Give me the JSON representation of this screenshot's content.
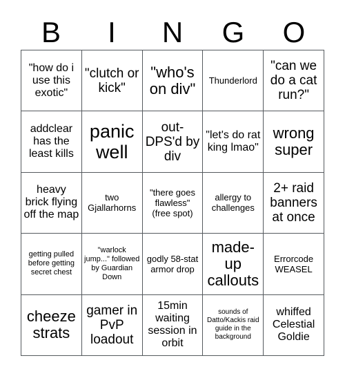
{
  "card": {
    "title": "BINGO",
    "colors": {
      "background": "#ffffff",
      "border": "#555a5e",
      "text": "#000000"
    },
    "header": {
      "letters": [
        {
          "label": "B"
        },
        {
          "label": "I"
        },
        {
          "label": "N"
        },
        {
          "label": "G"
        },
        {
          "label": "O"
        }
      ]
    },
    "grid": {
      "rows": 5,
      "columns": 5,
      "cells": [
        {
          "text": "\"how do i use this exotic\"",
          "size": "md",
          "marked": false
        },
        {
          "text": "\"clutch or kick\"",
          "size": "lg",
          "marked": false
        },
        {
          "text": "\"who's on div\"",
          "size": "xl",
          "marked": false
        },
        {
          "text": "Thunderlord",
          "size": "sm",
          "marked": false
        },
        {
          "text": "\"can we do a cat run?\"",
          "size": "lg",
          "marked": false
        },
        {
          "text": "addclear has the least kills",
          "size": "md",
          "marked": false
        },
        {
          "text": "panic well",
          "size": "xxl",
          "marked": false
        },
        {
          "text": "out-DPS'd by div",
          "size": "lg",
          "marked": false
        },
        {
          "text": "\"let's do rat king lmao\"",
          "size": "md",
          "marked": false
        },
        {
          "text": "wrong super",
          "size": "xl",
          "marked": false
        },
        {
          "text": "heavy brick flying off the map",
          "size": "md",
          "marked": false
        },
        {
          "text": "two Gjallarhorns",
          "size": "sm",
          "marked": false
        },
        {
          "text": "\"there goes flawless\" (free spot)",
          "size": "sm",
          "marked": false
        },
        {
          "text": "allergy to challenges",
          "size": "sm",
          "marked": false
        },
        {
          "text": "2+ raid banners at once",
          "size": "lg",
          "marked": false
        },
        {
          "text": "getting pulled before getting secret chest",
          "size": "xs",
          "marked": false
        },
        {
          "text": "\"warlock jump...\" followed by Guardian Down",
          "size": "xs",
          "marked": false
        },
        {
          "text": "godly 58-stat armor drop",
          "size": "sm",
          "marked": false
        },
        {
          "text": "made-up callouts",
          "size": "xl",
          "marked": false
        },
        {
          "text": "Errorcode WEASEL",
          "size": "sm",
          "marked": false
        },
        {
          "text": "cheeze strats",
          "size": "xl",
          "marked": false
        },
        {
          "text": "gamer in PvP loadout",
          "size": "lg",
          "marked": false
        },
        {
          "text": "15min waiting session in orbit",
          "size": "md",
          "marked": false
        },
        {
          "text": "sounds of Datto/Kackis raid guide in the background",
          "size": "xxs",
          "marked": false
        },
        {
          "text": "whiffed Celestial Goldie",
          "size": "md",
          "marked": false
        }
      ]
    }
  }
}
